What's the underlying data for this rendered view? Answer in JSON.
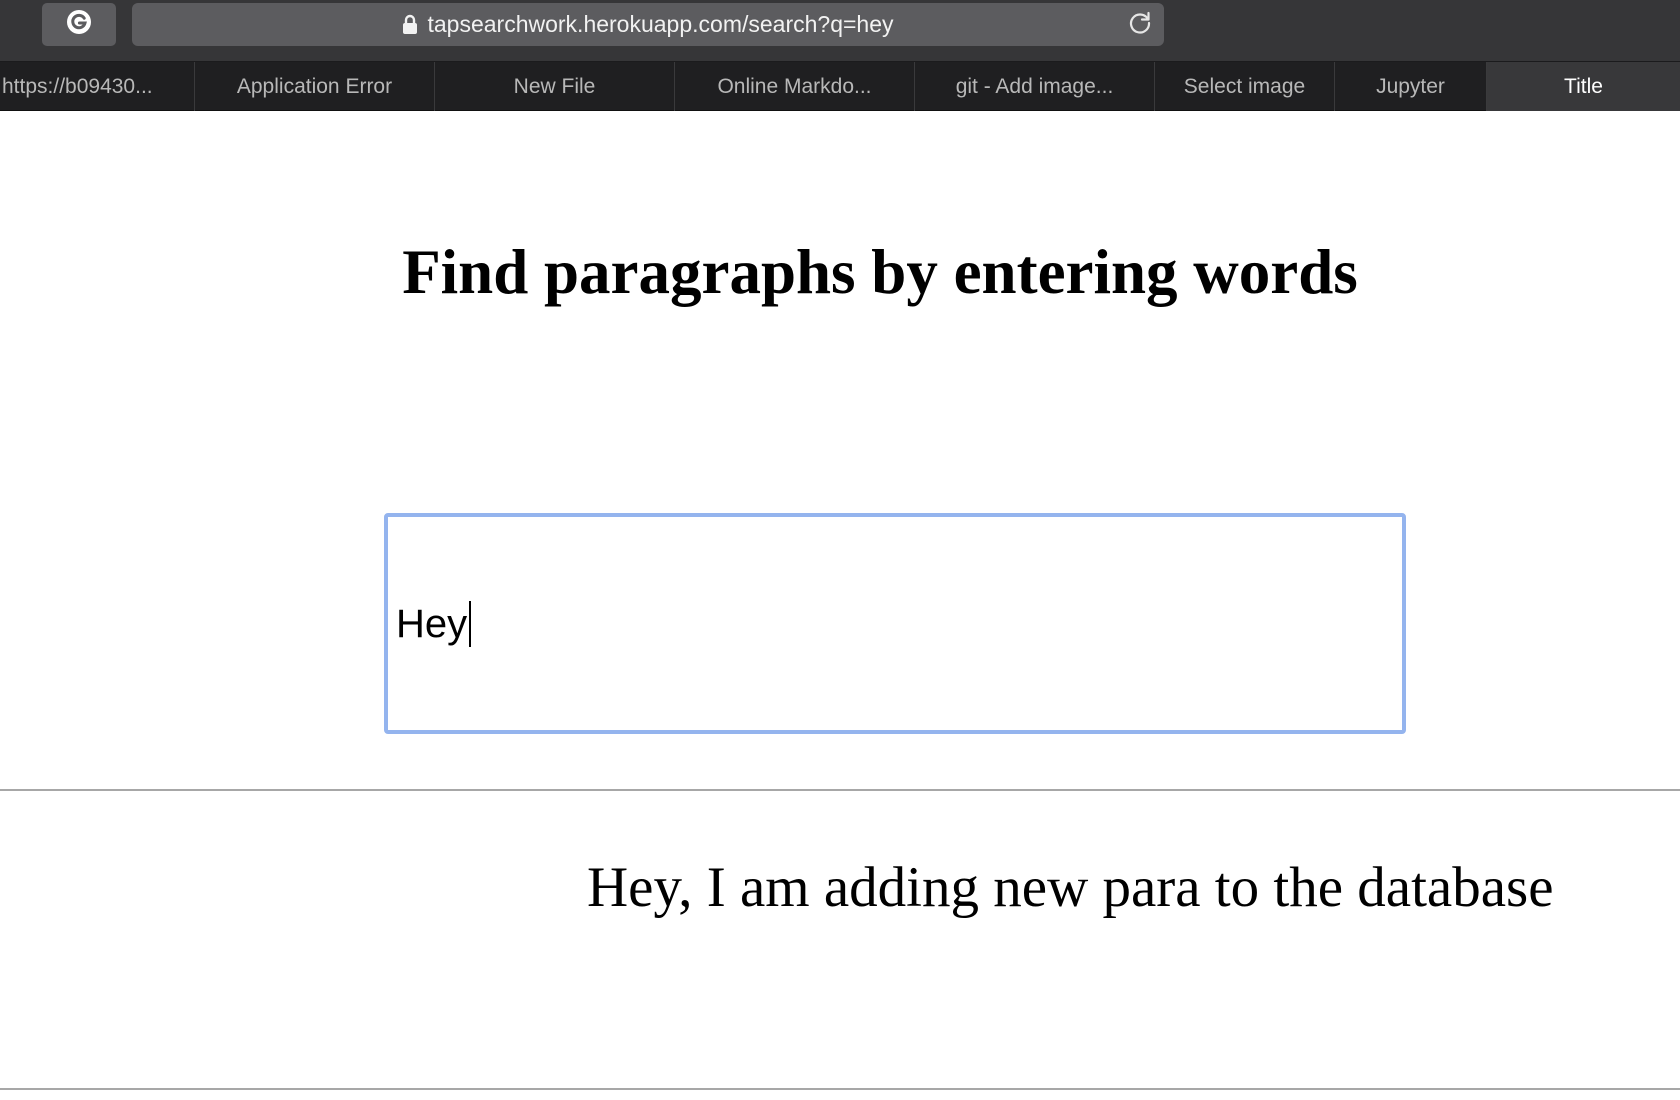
{
  "browser": {
    "url": "tapsearchwork.herokuapp.com/search?q=hey",
    "tabs": [
      {
        "label": "https://b09430..."
      },
      {
        "label": "Application Error"
      },
      {
        "label": "New File"
      },
      {
        "label": "Online Markdo..."
      },
      {
        "label": "git - Add image..."
      },
      {
        "label": "Select image"
      },
      {
        "label": "Jupyter"
      },
      {
        "label": "Title",
        "active": true
      }
    ],
    "icons": {
      "extension": "grammarly-icon",
      "lock": "lock-icon",
      "reload": "reload-icon"
    }
  },
  "page": {
    "heading": "Find paragraphs by entering words",
    "search": {
      "value": "Hey"
    },
    "results": [
      {
        "text": "Hey, I am adding new para to the database"
      }
    ]
  },
  "colors": {
    "focus_ring": "#94b4ee",
    "toolbar_bg": "#363638",
    "tabbar_bg": "#1f1f21",
    "active_tab_bg": "#38383a"
  }
}
